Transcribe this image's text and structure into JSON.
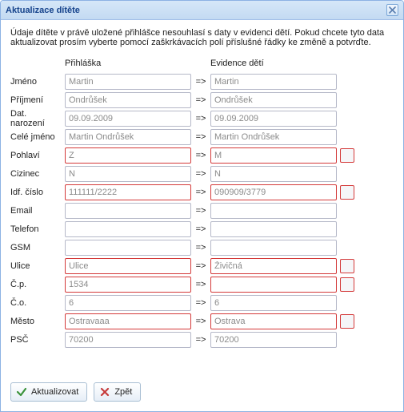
{
  "window": {
    "title": "Aktualizace dítěte"
  },
  "description": "Údaje dítěte v právě uložené přihlášce nesouhlasí s daty v evidenci dětí. Pokud chcete tyto data aktualizovat prosím vyberte pomocí zaškrkávacích polí příslušné řádky ke změně a potvrďte.",
  "headers": {
    "label": "",
    "app": "Přihláška",
    "evd": "Evidence dětí"
  },
  "arrow": "=>",
  "rows": {
    "jmeno": {
      "label": "Jméno",
      "app": "Martin",
      "evd": "Martin",
      "diff": false
    },
    "prijmeni": {
      "label": "Příjmení",
      "app": "Ondrůšek",
      "evd": "Ondrůšek",
      "diff": false
    },
    "datnar": {
      "label": "Dat. narození",
      "app": "09.09.2009",
      "evd": "09.09.2009",
      "diff": false
    },
    "celejm": {
      "label": "Celé jméno",
      "app": "Martin Ondrůšek",
      "evd": "Martin Ondrůšek",
      "diff": false
    },
    "pohlavi": {
      "label": "Pohlaví",
      "app": "Z",
      "evd": "M",
      "diff": true
    },
    "cizinec": {
      "label": "Cizinec",
      "app": "N",
      "evd": "N",
      "diff": false
    },
    "idf": {
      "label": "Idf. číslo",
      "app": "111111/2222",
      "evd": "090909/3779",
      "diff": true
    },
    "email": {
      "label": "Email",
      "app": "",
      "evd": "",
      "diff": false
    },
    "telefon": {
      "label": "Telefon",
      "app": "",
      "evd": "",
      "diff": false
    },
    "gsm": {
      "label": "GSM",
      "app": "",
      "evd": "",
      "diff": false
    },
    "ulice": {
      "label": "Ulice",
      "app": "Ulice",
      "evd": "Živičná",
      "diff": true
    },
    "cp": {
      "label": "Č.p.",
      "app": "1534",
      "evd": "",
      "diff": true
    },
    "co": {
      "label": "Č.o.",
      "app": "6",
      "evd": "6",
      "diff": false
    },
    "mesto": {
      "label": "Město",
      "app": "Ostravaaa",
      "evd": "Ostrava",
      "diff": true
    },
    "psc": {
      "label": "PSČ",
      "app": "70200",
      "evd": "70200",
      "diff": false
    }
  },
  "buttons": {
    "update": "Aktualizovat",
    "back": "Zpět"
  }
}
